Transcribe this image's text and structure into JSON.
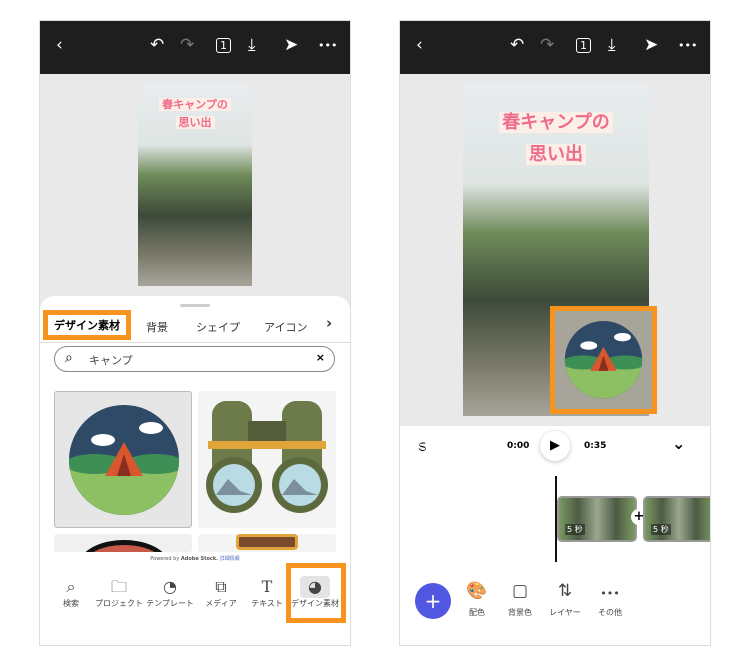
{
  "left": {
    "topbar": {
      "back": "‹",
      "undo": "↶",
      "redo": "↷",
      "pages": "1",
      "download": "⤓",
      "share": "➤",
      "more": "•••"
    },
    "photo_title": [
      "春キャンプの",
      "思い出"
    ],
    "tabs": [
      "デザイン素材",
      "背景",
      "シェイプ",
      "アイコン"
    ],
    "tabs_next": "›",
    "search": {
      "value": "キャンプ",
      "clear": "×"
    },
    "powered": {
      "text": "Powered by ",
      "brand": "Adobe Stock.",
      "link": "詳細情報"
    },
    "nav": [
      {
        "icon": "⌕",
        "label": "検索"
      },
      {
        "icon": "🗀",
        "label": "プロジェクト"
      },
      {
        "icon": "◔",
        "label": "テンプレート"
      },
      {
        "icon": "⧉",
        "label": "メディア"
      },
      {
        "icon": "T",
        "label": "テキスト"
      },
      {
        "icon": "◕",
        "label": "デザイン素材"
      }
    ]
  },
  "right": {
    "topbar": {
      "back": "‹",
      "undo": "↶",
      "redo": "↷",
      "pages": "1",
      "download": "⤓",
      "share": "➤",
      "more": "•••"
    },
    "photo_title": [
      "春キャンプの",
      "思い出"
    ],
    "player": {
      "current": "0:00",
      "total": "0:35",
      "play": "▶",
      "collapse": "⌄",
      "speed": "ಽ"
    },
    "clips": [
      {
        "duration": "5 秒"
      },
      {
        "duration": "5 秒"
      }
    ],
    "add_between": "+",
    "add": "+",
    "tools": [
      {
        "icon": "🎨",
        "label": "配色"
      },
      {
        "icon": "▢",
        "label": "背景色"
      },
      {
        "icon": "⇅",
        "label": "レイヤー"
      },
      {
        "icon": "•••",
        "label": "その他"
      }
    ]
  },
  "colors": {
    "accent": "#f7931e",
    "add_button": "#5157e0",
    "topbar": "#1e1e1e"
  }
}
